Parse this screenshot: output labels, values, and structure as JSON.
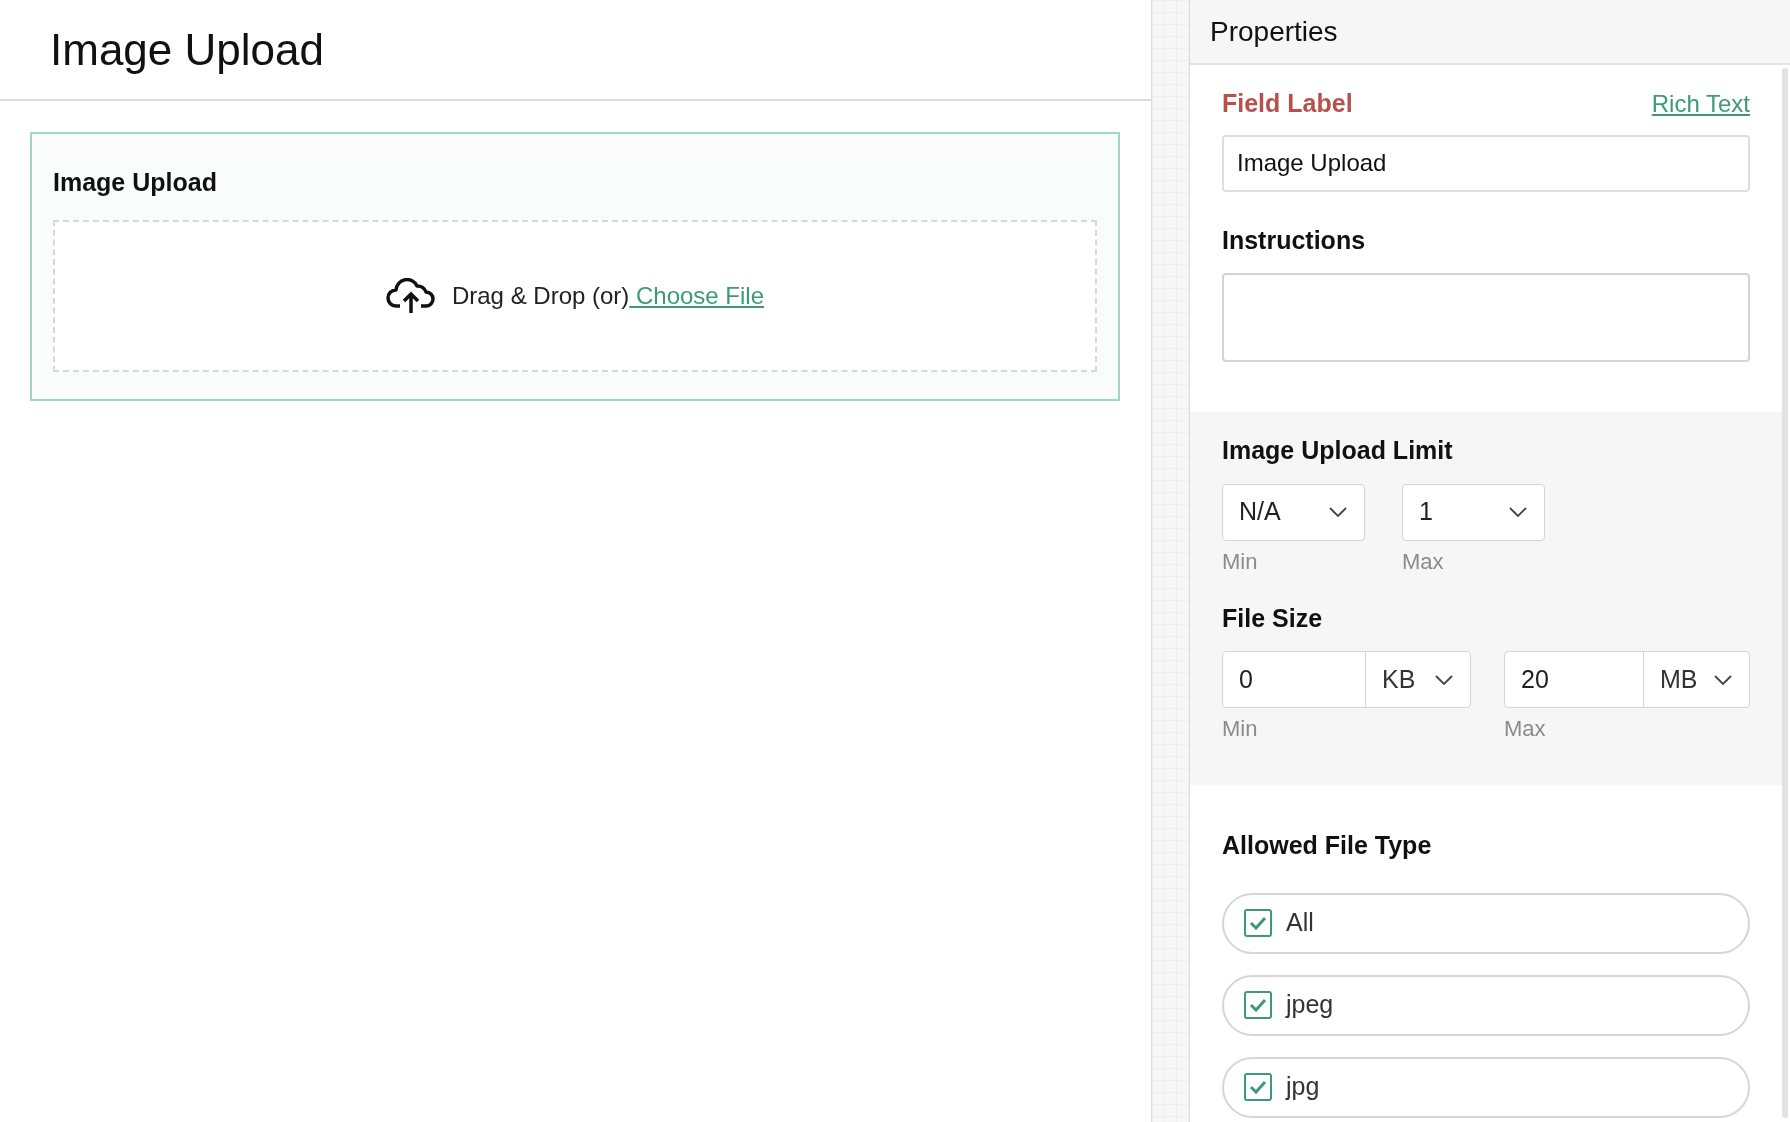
{
  "page_title": "Image Upload",
  "field_preview": {
    "label": "Image Upload",
    "drop_text": "Drag & Drop (or)",
    "choose_link": " Choose File"
  },
  "properties": {
    "title": "Properties",
    "field_label": {
      "label": "Field Label",
      "rich_text_link": "Rich Text",
      "value": "Image Upload"
    },
    "instructions": {
      "label": "Instructions"
    },
    "upload_limit": {
      "label": "Image Upload Limit",
      "min": {
        "value": "N/A",
        "caption": "Min"
      },
      "max": {
        "value": "1",
        "caption": "Max"
      }
    },
    "file_size": {
      "label": "File Size",
      "min": {
        "value": "0",
        "unit": "KB",
        "caption": "Min"
      },
      "max": {
        "value": "20",
        "unit": "MB",
        "caption": "Max"
      }
    },
    "allowed_types": {
      "label": "Allowed File Type",
      "items": [
        {
          "label": "All",
          "checked": true
        },
        {
          "label": "jpeg",
          "checked": true
        },
        {
          "label": "jpg",
          "checked": true
        }
      ]
    }
  }
}
